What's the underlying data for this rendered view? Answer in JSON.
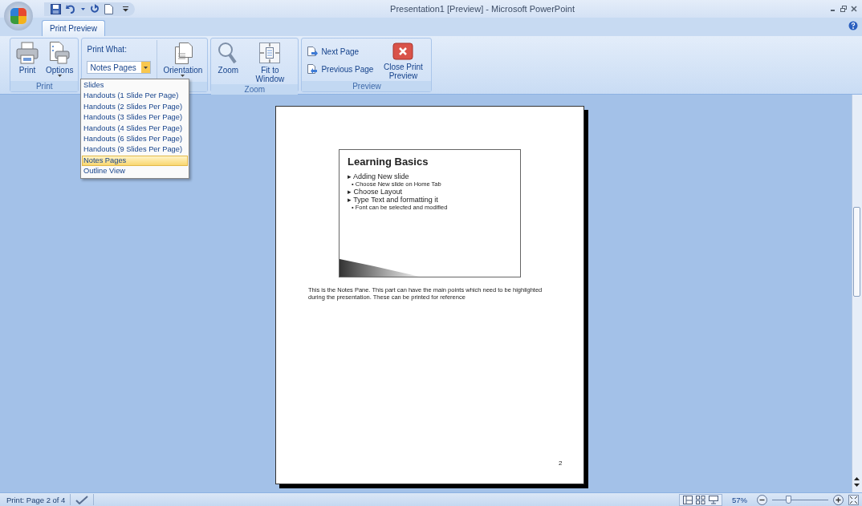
{
  "window": {
    "title": "Presentation1 [Preview] - Microsoft PowerPoint"
  },
  "tabs": [
    {
      "label": "Print Preview",
      "selected": true
    }
  ],
  "ribbon": {
    "groups": [
      {
        "label": "Print",
        "buttons": [
          {
            "kind": "large",
            "label": "Print"
          },
          {
            "kind": "large",
            "label": "Options",
            "menu": true
          }
        ]
      },
      {
        "print_what": {
          "label": "Print What:",
          "value": "Notes Pages"
        },
        "buttons": [
          {
            "kind": "large",
            "label": "Orientation",
            "menu": true
          }
        ]
      },
      {
        "label": "Zoom",
        "buttons": [
          {
            "kind": "large",
            "label": "Zoom"
          },
          {
            "kind": "large",
            "label": "Fit to Window"
          }
        ]
      },
      {
        "label": "Preview",
        "buttons": [
          {
            "kind": "small",
            "label": "Next Page"
          },
          {
            "kind": "small",
            "label": "Previous Page"
          },
          {
            "kind": "large",
            "label": "Close Print Preview"
          }
        ]
      }
    ]
  },
  "print_what_menu": {
    "items": [
      {
        "label": "Slides",
        "selected": false
      },
      {
        "label": "Handouts (1 Slide Per Page)",
        "selected": false
      },
      {
        "label": "Handouts (2 Slides Per Page)",
        "selected": false
      },
      {
        "label": "Handouts (3 Slides Per Page)",
        "selected": false
      },
      {
        "label": "Handouts (4 Slides Per Page)",
        "selected": false
      },
      {
        "label": "Handouts (6 Slides Per Page)",
        "selected": false
      },
      {
        "label": "Handouts (9 Slides Per Page)",
        "selected": false
      },
      {
        "label": "Notes Pages",
        "selected": true
      },
      {
        "label": "Outline View",
        "selected": false
      }
    ]
  },
  "page": {
    "slide": {
      "title": "Learning Basics",
      "bullets": [
        {
          "text": "▸ Adding New slide",
          "children": [
            {
              "text": "• Choose New slide on Home Tab"
            }
          ]
        },
        {
          "text": "▸ Choose Layout"
        },
        {
          "text": "▸ Type Text and formatting it",
          "children": [
            {
              "text": "• Font can be selected and modified"
            }
          ]
        }
      ]
    },
    "notes": "This is the Notes Pane. This part can have the main points which need to be highlighted during the presentation. These can be printed for reference",
    "page_number": "2"
  },
  "status_bar": {
    "page": "Print: Page 2 of 4",
    "zoom": "57%",
    "zoom_slider": {
      "level": 0.3
    }
  }
}
